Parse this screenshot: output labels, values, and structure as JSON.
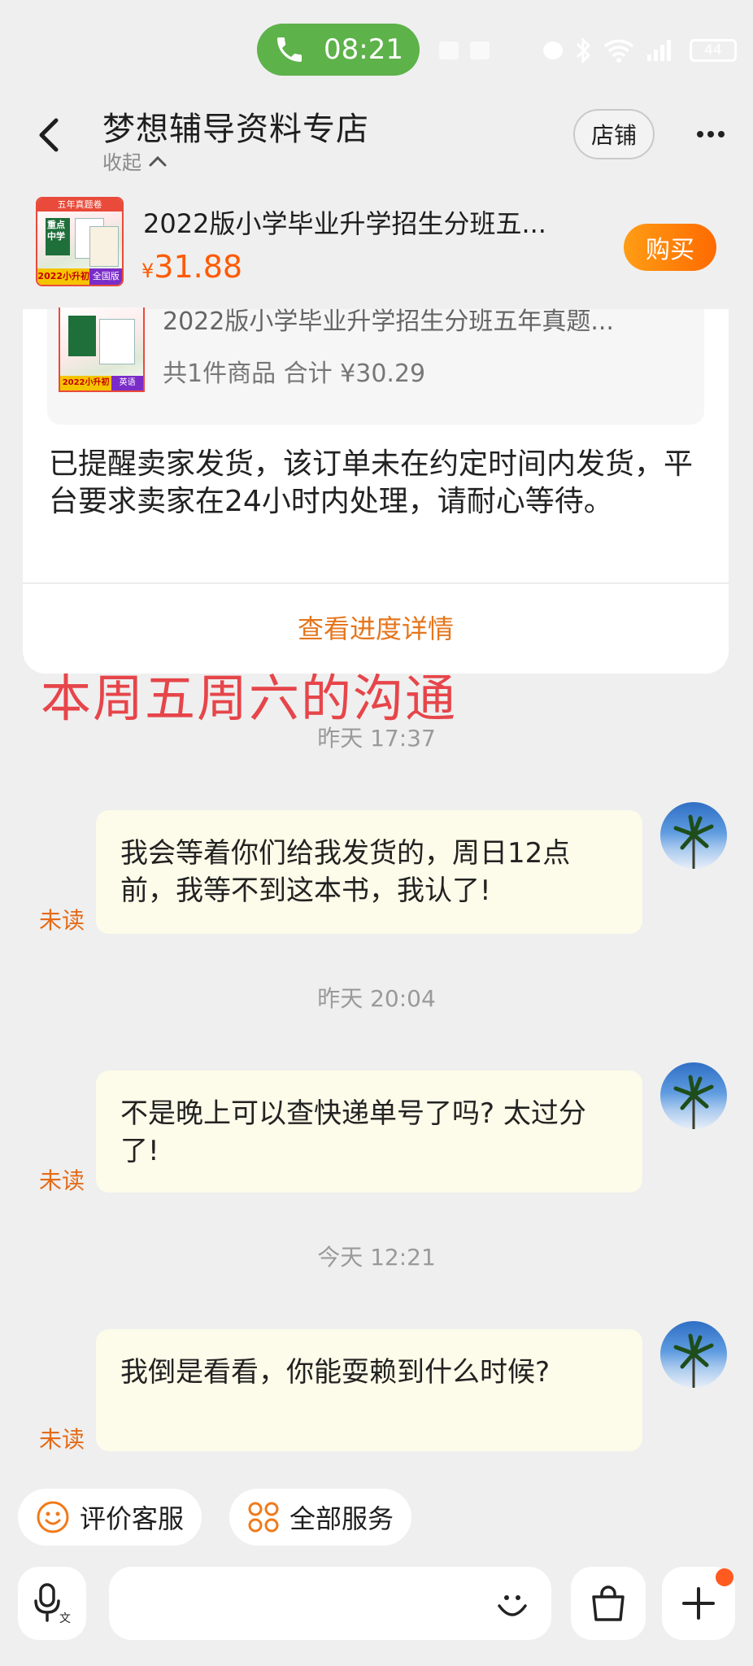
{
  "status_bar": {
    "time": "08:21",
    "battery": "44"
  },
  "header": {
    "shop_name": "梦想辅导资料专店",
    "collapse_label": "收起",
    "shop_button": "店铺"
  },
  "product": {
    "title": "2022版小学毕业升学招生分班五...",
    "price_symbol": "¥",
    "price": "31.88",
    "buy_label": "购买",
    "image_labels": {
      "top": "五年真题卷",
      "main": "重点中学",
      "bottom_left": "2022小升初",
      "bottom_right": "全国版"
    }
  },
  "order_card": {
    "item_title": "2022版小学毕业升学招生分班五年真题...",
    "total": "共1件商品 合计 ¥30.29",
    "image_labels": {
      "bottom_left": "2022小升初",
      "bottom_right": "英语"
    },
    "notice": "已提醒卖家发货，该订单未在约定时间内发货，平台要求卖家在24小时内处理，请耐心等待。",
    "progress_link": "查看进度详情"
  },
  "overlay_caption": "本周五周六的沟通",
  "messages": [
    {
      "timestamp": "昨天  17:37",
      "text": "我会等着你们给我发货的，周日12点前，我等不到这本书，我认了!",
      "status": "未读"
    },
    {
      "timestamp": "昨天  20:04",
      "text": "不是晚上可以查快递单号了吗? 太过分了!",
      "status": "未读"
    },
    {
      "timestamp": "今天  12:21",
      "text": "我倒是看看，你能耍赖到什么时候?",
      "status": "未读"
    }
  ],
  "quick_actions": {
    "rate_service": "评价客服",
    "all_services": "全部服务"
  },
  "colors": {
    "accent_orange": "#ff6a00",
    "price_orange": "#ff5a00",
    "call_green": "#5db24a",
    "bubble_bg": "#fdfbe9",
    "overlay_red": "#e6454a"
  }
}
